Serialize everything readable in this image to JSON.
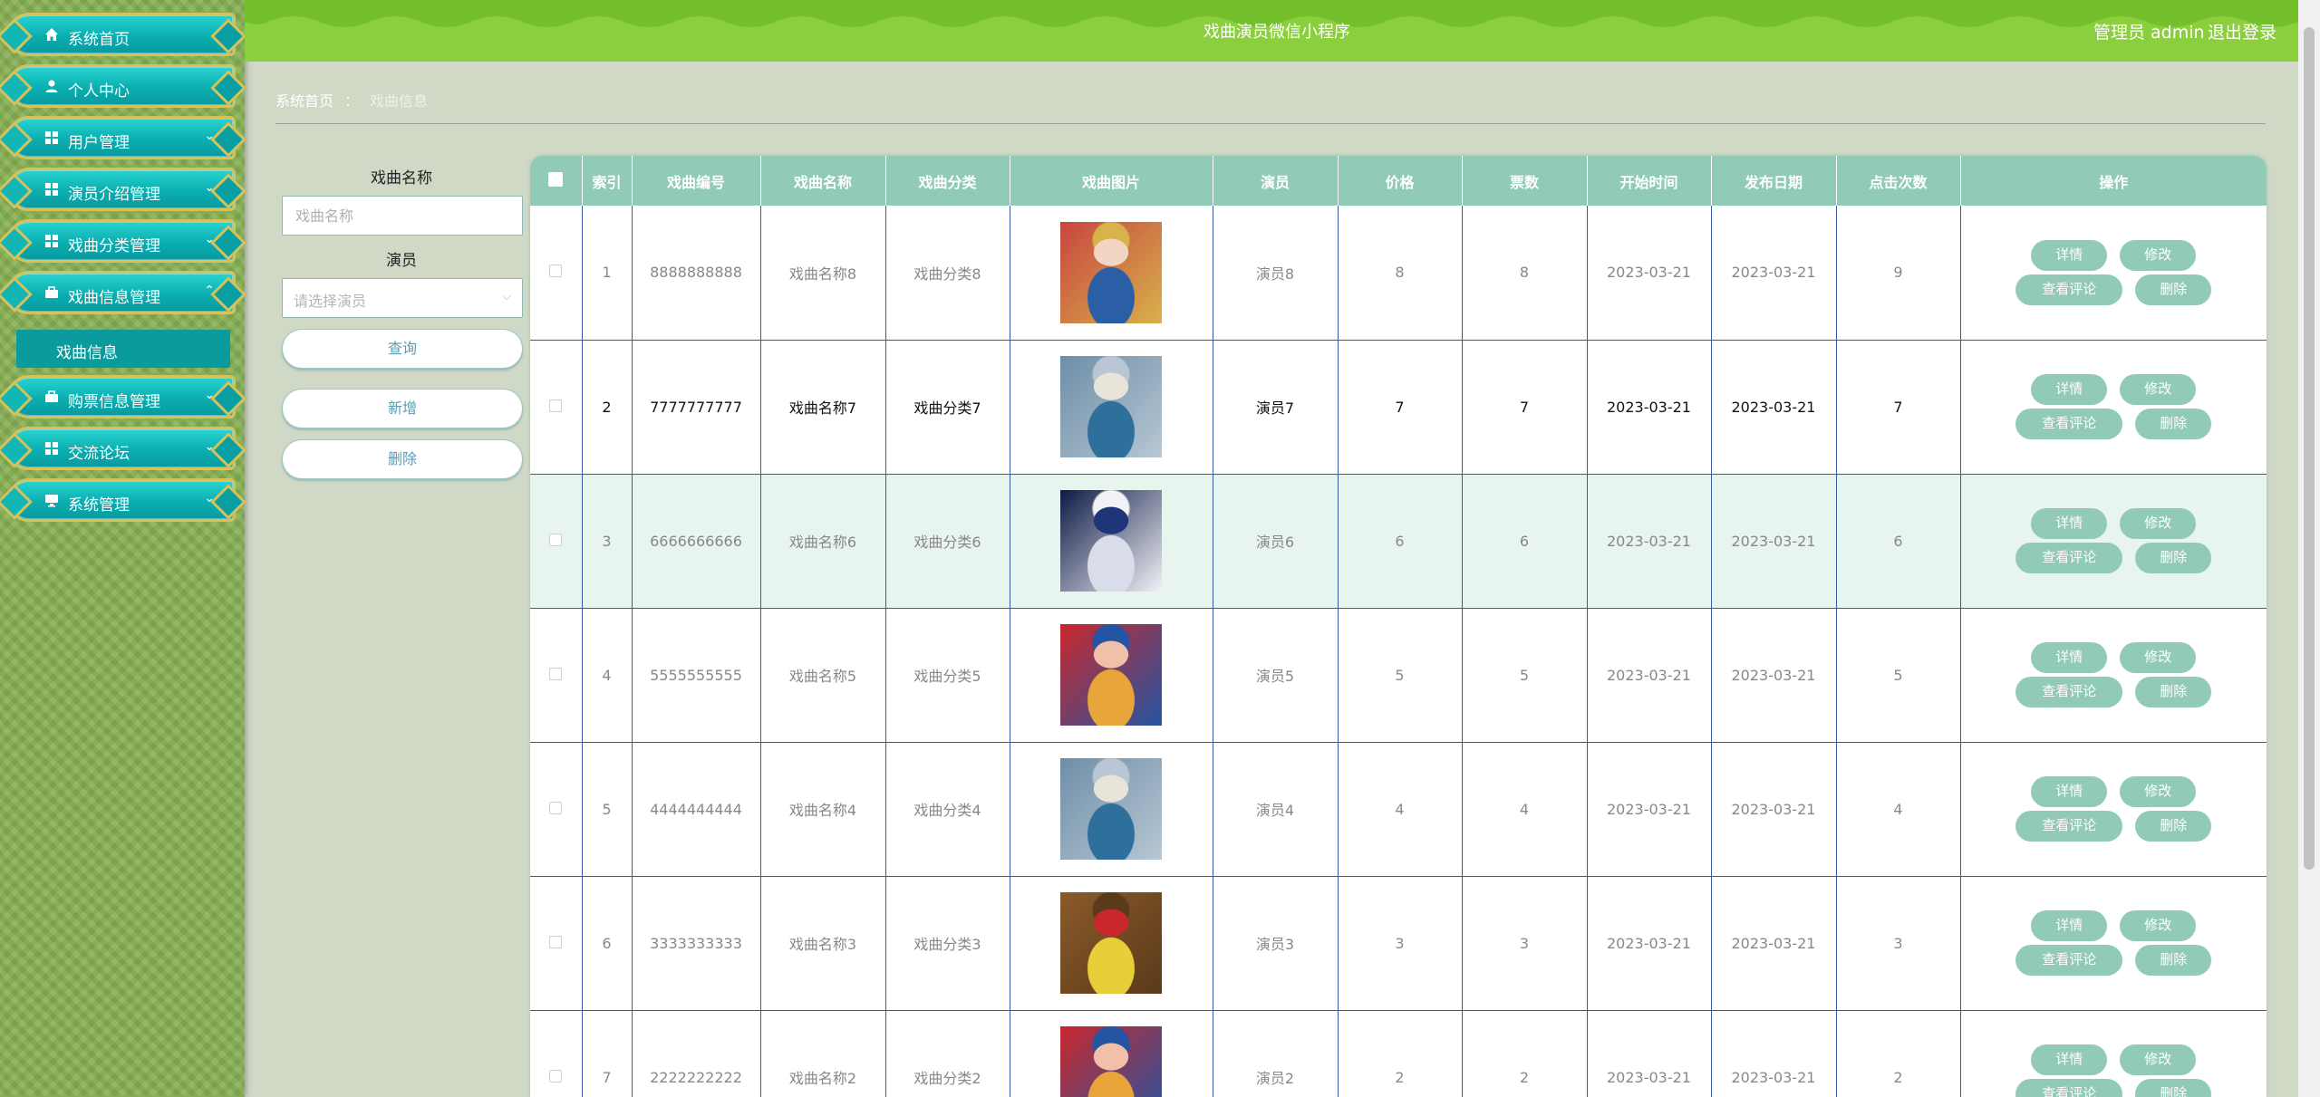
{
  "sidebar": {
    "items": [
      {
        "label": "系统首页",
        "icon": "home-icon"
      },
      {
        "label": "个人中心",
        "icon": "person-icon"
      },
      {
        "label": "用户管理",
        "icon": "grid-icon"
      },
      {
        "label": "演员介绍管理",
        "icon": "grid-icon"
      },
      {
        "label": "戏曲分类管理",
        "icon": "grid-icon"
      },
      {
        "label": "戏曲信息管理",
        "icon": "briefcase-icon"
      },
      {
        "label": "购票信息管理",
        "icon": "briefcase-icon"
      },
      {
        "label": "交流论坛",
        "icon": "grid-icon"
      },
      {
        "label": "系统管理",
        "icon": "monitor-icon"
      }
    ],
    "active_sub": "戏曲信息"
  },
  "header": {
    "title": "戏曲演员微信小程序",
    "admin": "管理员 admin",
    "logout": "退出登录"
  },
  "breadcrumb": {
    "home": "系统首页",
    "sep": "：",
    "current": "戏曲信息"
  },
  "search": {
    "name_label": "戏曲名称",
    "name_placeholder": "戏曲名称",
    "actor_label": "演员",
    "actor_placeholder": "请选择演员",
    "query_btn": "查询",
    "add_btn": "新增",
    "delete_btn": "删除"
  },
  "table": {
    "headers": [
      "索引",
      "戏曲编号",
      "戏曲名称",
      "戏曲分类",
      "戏曲图片",
      "演员",
      "价格",
      "票数",
      "开始时间",
      "发布日期",
      "点击次数",
      "操作"
    ],
    "ops": {
      "detail": "详情",
      "edit": "修改",
      "comments": "查看评论",
      "delete": "删除"
    },
    "rows": [
      {
        "index": "1",
        "code": "8888888888",
        "name": "戏曲名称8",
        "category": "戏曲分类8",
        "actor": "演员8",
        "price": "8",
        "tickets": "8",
        "start": "2023-03-21",
        "publish": "2023-03-21",
        "clicks": "9"
      },
      {
        "index": "2",
        "code": "7777777777",
        "name": "戏曲名称7",
        "category": "戏曲分类7",
        "actor": "演员7",
        "price": "7",
        "tickets": "7",
        "start": "2023-03-21",
        "publish": "2023-03-21",
        "clicks": "7"
      },
      {
        "index": "3",
        "code": "6666666666",
        "name": "戏曲名称6",
        "category": "戏曲分类6",
        "actor": "演员6",
        "price": "6",
        "tickets": "6",
        "start": "2023-03-21",
        "publish": "2023-03-21",
        "clicks": "6"
      },
      {
        "index": "4",
        "code": "5555555555",
        "name": "戏曲名称5",
        "category": "戏曲分类5",
        "actor": "演员5",
        "price": "5",
        "tickets": "5",
        "start": "2023-03-21",
        "publish": "2023-03-21",
        "clicks": "5"
      },
      {
        "index": "5",
        "code": "4444444444",
        "name": "戏曲名称4",
        "category": "戏曲分类4",
        "actor": "演员4",
        "price": "4",
        "tickets": "4",
        "start": "2023-03-21",
        "publish": "2023-03-21",
        "clicks": "4"
      },
      {
        "index": "6",
        "code": "3333333333",
        "name": "戏曲名称3",
        "category": "戏曲分类3",
        "actor": "演员3",
        "price": "3",
        "tickets": "3",
        "start": "2023-03-21",
        "publish": "2023-03-21",
        "clicks": "3"
      },
      {
        "index": "7",
        "code": "2222222222",
        "name": "戏曲名称2",
        "category": "戏曲分类2",
        "actor": "演员2",
        "price": "2",
        "tickets": "2",
        "start": "2023-03-21",
        "publish": "2023-03-21",
        "clicks": "2"
      }
    ]
  },
  "colors": {
    "accent": "#92cbb5",
    "header": "#8ccf3e",
    "sidebar": "#84ad4f",
    "menu": "#0aaeb0"
  }
}
